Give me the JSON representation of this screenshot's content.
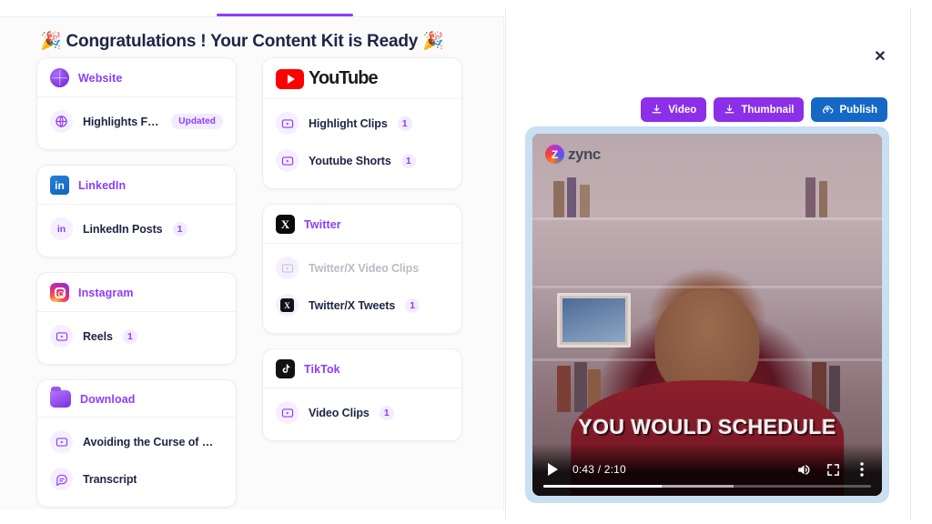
{
  "left_panel": {
    "title": "🎉 Congratulations ! Your Content Kit is Ready 🎉",
    "cards": [
      {
        "brand": "Website",
        "logo": "website-globe-icon",
        "rows": [
          {
            "label": "Highlights Feed",
            "icon": "globe-icon",
            "badge": "Updated"
          }
        ]
      },
      {
        "brand": "LinkedIn",
        "logo": "linkedin-icon",
        "rows": [
          {
            "label": "LinkedIn Posts",
            "icon": "linkedin-small-icon",
            "count": "1"
          }
        ]
      },
      {
        "brand": "Instagram",
        "logo": "instagram-icon",
        "rows": [
          {
            "label": "Reels",
            "icon": "video-clip-icon",
            "count": "1"
          }
        ]
      },
      {
        "brand": "Download",
        "logo": "folder-icon",
        "rows": [
          {
            "label": "Avoiding the Curse of K…",
            "icon": "video-clip-icon"
          },
          {
            "label": "Transcript",
            "icon": "transcript-icon"
          }
        ]
      },
      {
        "brand": "YouTube",
        "logo": "youtube-icon",
        "rows": [
          {
            "label": "Highlight Clips",
            "icon": "video-clip-icon",
            "count": "1"
          },
          {
            "label": "Youtube Shorts",
            "icon": "video-clip-icon",
            "count": "1"
          }
        ]
      },
      {
        "brand": "Twitter",
        "logo": "twitter-x-icon",
        "rows": [
          {
            "label": "Twitter/X Video Clips",
            "icon": "video-clip-icon",
            "disabled": true
          },
          {
            "label": "Twitter/X Tweets",
            "icon": "twitter-x-small-icon",
            "count": "1"
          }
        ]
      },
      {
        "brand": "TikTok",
        "logo": "tiktok-icon",
        "rows": [
          {
            "label": "Video Clips",
            "icon": "video-clip-icon",
            "count": "1"
          }
        ]
      }
    ]
  },
  "right_panel": {
    "close_label": "✕",
    "actions": [
      {
        "label": "Video",
        "icon": "download-icon",
        "color": "#8b2fe8"
      },
      {
        "label": "Thumbnail",
        "icon": "download-icon",
        "color": "#8b2fe8"
      },
      {
        "label": "Publish",
        "icon": "upload-cloud-icon",
        "color": "#1668c7"
      }
    ],
    "video": {
      "watermark": "zync",
      "caption": "YOU WOULD SCHEDULE",
      "time": "0:43 / 2:10",
      "played_percent": 36,
      "buffered_percent": 58
    }
  },
  "colors": {
    "accent_purple": "#8b3dff",
    "publish_blue": "#1668c7",
    "title_navy": "#1e2445",
    "badge_bg": "#f3ebff"
  }
}
